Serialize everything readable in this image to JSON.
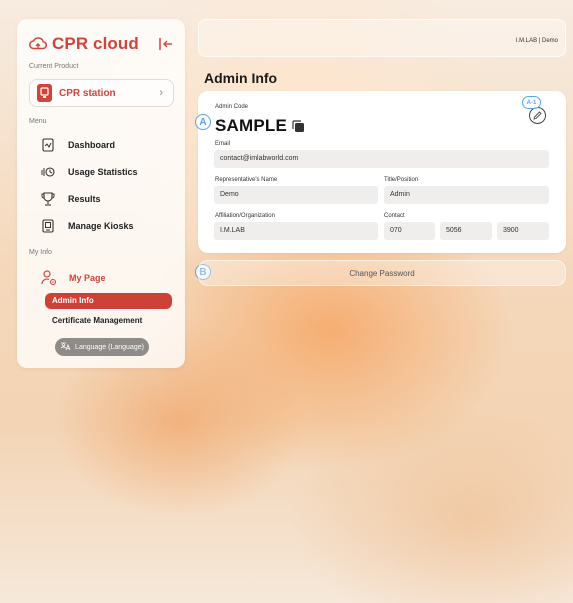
{
  "app": {
    "brand": "CPR cloud"
  },
  "sidebar": {
    "current_product_label": "Current Product",
    "product_name": "CPR station",
    "menu_label": "Menu",
    "menu_items": [
      {
        "label": "Dashboard",
        "icon": "dashboard-icon"
      },
      {
        "label": "Usage Statistics",
        "icon": "usage-statistics-icon"
      },
      {
        "label": "Results",
        "icon": "trophy-icon"
      },
      {
        "label": "Manage Kiosks",
        "icon": "kiosk-icon"
      }
    ],
    "myinfo_label": "My Info",
    "my_page_label": "My Page",
    "sub_items": [
      "Admin Info",
      "Certificate Management"
    ],
    "language_button": "Language (Language)"
  },
  "topbar": {
    "user_text": "I.M.LAB | Demo"
  },
  "page": {
    "title": "Admin Info"
  },
  "admin_card": {
    "code_label": "Admin Code",
    "code_value": "SAMPLE",
    "email_label": "Email",
    "email_value": "contact@imlabworld.com",
    "rep_name_label": "Representative's Name",
    "rep_name_value": "Demo",
    "title_label": "Title/Position",
    "title_value": "Admin",
    "org_label": "Affiliation/Organization",
    "org_value": "I.M.LAB",
    "contact_label": "Contact",
    "contact_values": [
      "070",
      "5056",
      "3900"
    ]
  },
  "markers": {
    "a": "A",
    "a1": "A-1",
    "b": "B"
  },
  "change_password_label": "Change Password",
  "colors": {
    "accent": "#d2433a",
    "marker": "#5aa4e6"
  }
}
